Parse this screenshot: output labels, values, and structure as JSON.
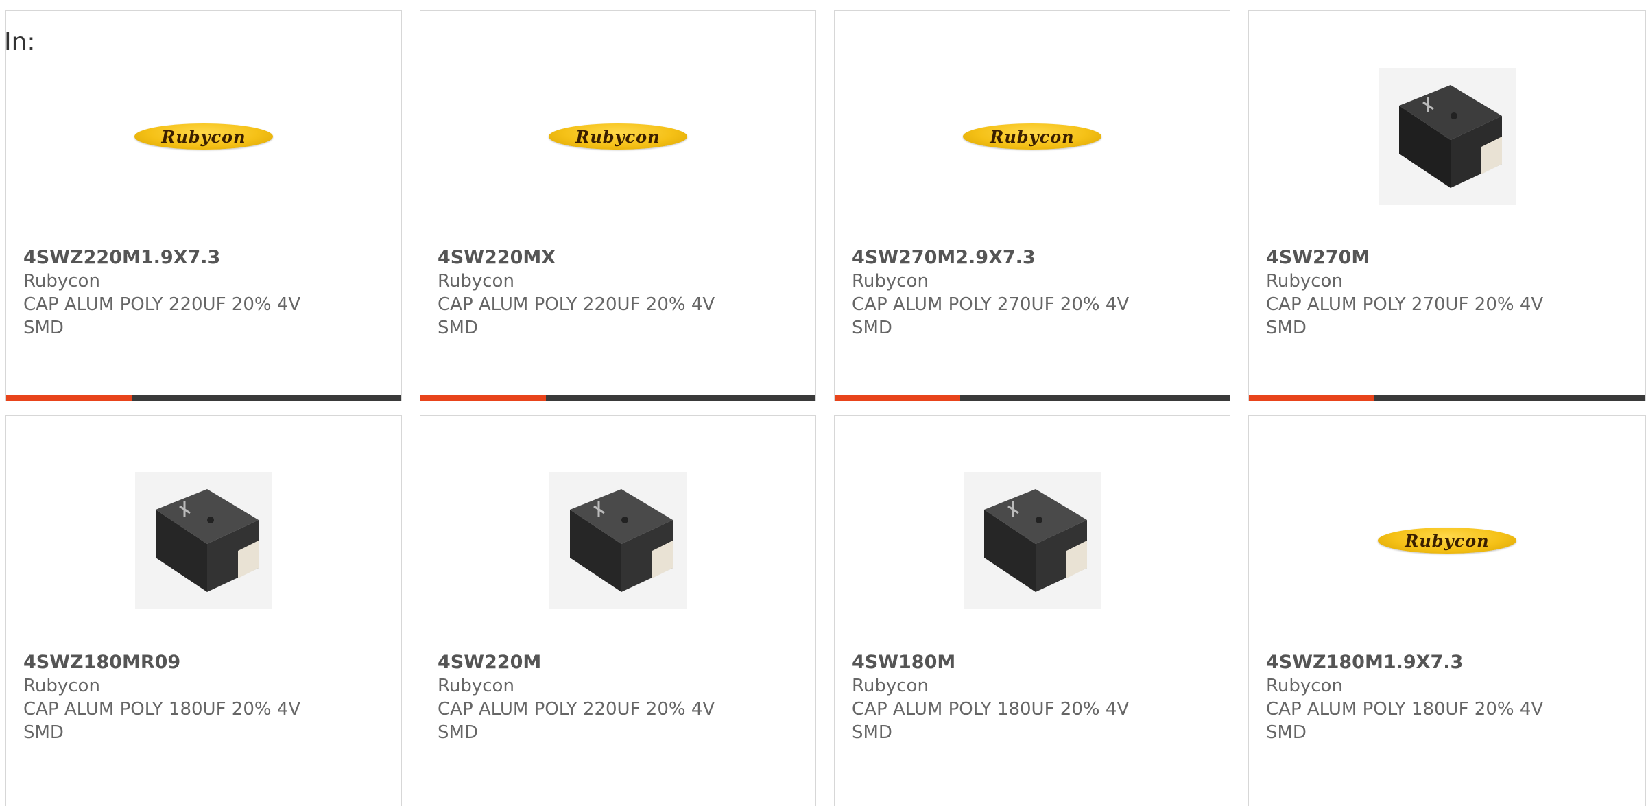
{
  "header": {
    "in_label": "In:"
  },
  "colors": {
    "accent": "#e8441b",
    "bar_track": "#3a3a3a",
    "border": "#d7d7d7"
  },
  "products": [
    {
      "part_number": "4SWZ220M1.9X7.3",
      "manufacturer": "Rubycon",
      "description": "CAP ALUM POLY 220UF 20% 4V SMD",
      "image": "rubycon-logo",
      "logo_text": "Rubycon"
    },
    {
      "part_number": "4SW220MX",
      "manufacturer": "Rubycon",
      "description": "CAP ALUM POLY 220UF 20% 4V SMD",
      "image": "rubycon-logo",
      "logo_text": "Rubycon"
    },
    {
      "part_number": "4SW270M2.9X7.3",
      "manufacturer": "Rubycon",
      "description": "CAP ALUM POLY 270UF 20% 4V SMD",
      "image": "rubycon-logo",
      "logo_text": "Rubycon"
    },
    {
      "part_number": "4SW270M",
      "manufacturer": "Rubycon",
      "description": "CAP ALUM POLY 270UF 20% 4V SMD",
      "image": "smd-capacitor-photo"
    },
    {
      "part_number": "4SWZ180MR09",
      "manufacturer": "Rubycon",
      "description": "CAP ALUM POLY 180UF 20% 4V SMD",
      "image": "smd-capacitor-photo"
    },
    {
      "part_number": "4SW220M",
      "manufacturer": "Rubycon",
      "description": "CAP ALUM POLY 220UF 20% 4V SMD",
      "image": "smd-capacitor-photo"
    },
    {
      "part_number": "4SW180M",
      "manufacturer": "Rubycon",
      "description": "CAP ALUM POLY 180UF 20% 4V SMD",
      "image": "smd-capacitor-photo"
    },
    {
      "part_number": "4SWZ180M1.9X7.3",
      "manufacturer": "Rubycon",
      "description": "CAP ALUM POLY 180UF 20% 4V SMD",
      "image": "rubycon-logo",
      "logo_text": "Rubycon"
    }
  ]
}
